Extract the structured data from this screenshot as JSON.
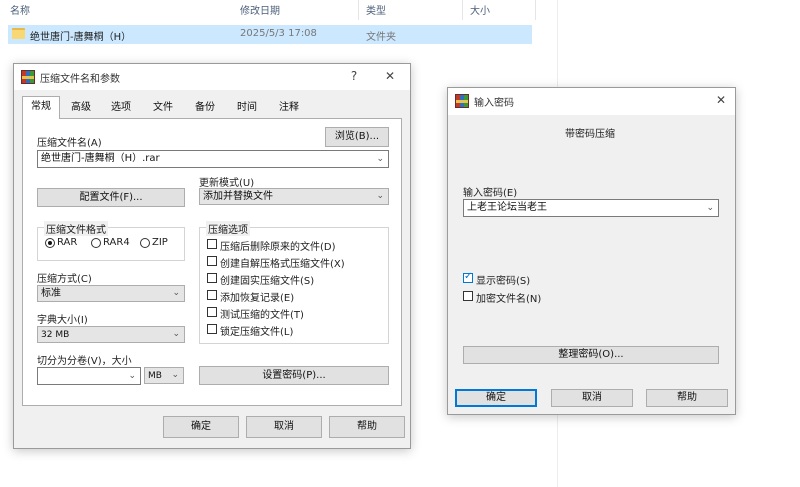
{
  "explorer": {
    "columns": {
      "name": "名称",
      "date": "修改日期",
      "type": "类型",
      "size": "大小"
    },
    "row": {
      "name": "绝世唐门-唐舞桐（H）",
      "date": "2025/5/3 17:08",
      "type": "文件夹"
    }
  },
  "archive_dialog": {
    "title": "压缩文件名和参数",
    "help_glyph": "?",
    "close_glyph": "✕",
    "tabs": [
      "常规",
      "高级",
      "选项",
      "文件",
      "备份",
      "时间",
      "注释"
    ],
    "archive_name_label": "压缩文件名(A)",
    "browse_button": "浏览(B)...",
    "archive_name_value": "绝世唐门-唐舞桐（H）.rar",
    "profiles_button": "配置文件(F)...",
    "update_mode_label": "更新模式(U)",
    "update_mode_value": "添加并替换文件",
    "format_group": "压缩文件格式",
    "formats": [
      "RAR",
      "RAR4",
      "ZIP"
    ],
    "method_label": "压缩方式(C)",
    "method_value": "标准",
    "dict_label": "字典大小(I)",
    "dict_value": "32 MB",
    "split_label": "切分为分卷(V)，大小",
    "split_value": "",
    "split_unit": "MB",
    "options_group": "压缩选项",
    "options": [
      "压缩后删除原来的文件(D)",
      "创建自解压格式压缩文件(X)",
      "创建固实压缩文件(S)",
      "添加恢复记录(E)",
      "测试压缩的文件(T)",
      "锁定压缩文件(L)"
    ],
    "set_password_button": "设置密码(P)...",
    "ok_button": "确定",
    "cancel_button": "取消",
    "help_button": "帮助"
  },
  "password_dialog": {
    "title": "输入密码",
    "close_glyph": "✕",
    "heading": "带密码压缩",
    "password_label": "输入密码(E)",
    "password_value": "上老王论坛当老王",
    "show_password_label": "显示密码(S)",
    "encrypt_names_label": "加密文件名(N)",
    "organize_button": "整理密码(O)...",
    "ok_button": "确定",
    "cancel_button": "取消",
    "help_button": "帮助"
  },
  "icons": {
    "folder": "folder-icon",
    "app": "winrar-icon",
    "chevron": "chevron-down-icon"
  }
}
